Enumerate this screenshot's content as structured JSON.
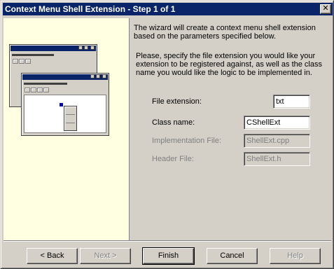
{
  "window": {
    "title": "Context Menu Shell Extension - Step 1 of 1",
    "close_glyph": "✕"
  },
  "intro": {
    "line1": "The wizard will create a context menu shell extension based on the parameters specified below.",
    "line2": "Please, specify the file extension you would like your extension to be registered against, as well as the class name you would like the logic to be implemented in."
  },
  "form": {
    "file_extension": {
      "label": "File extension:",
      "value": "txt"
    },
    "class_name": {
      "label": "Class name:",
      "value": "CShellExt"
    },
    "implementation_file": {
      "label": "Implementation File:",
      "value": "ShellExt.cpp"
    },
    "header_file": {
      "label": "Header File:",
      "value": "ShellExt.h"
    }
  },
  "buttons": {
    "back": "< Back",
    "next": "Next >",
    "finish": "Finish",
    "cancel": "Cancel",
    "help": "Help"
  },
  "colors": {
    "titlebar": "#0a246a",
    "face": "#d4d0c8",
    "info_panel": "#ffffe1"
  }
}
